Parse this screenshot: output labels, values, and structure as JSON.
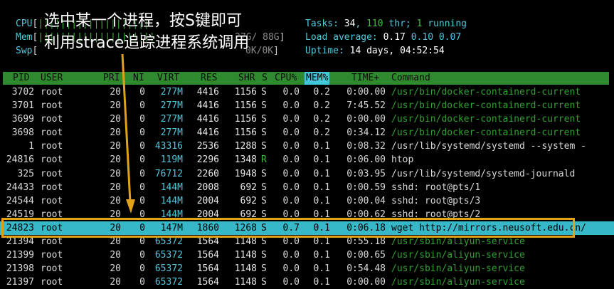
{
  "meters": {
    "cpu": {
      "label": "CPU",
      "bar": "||||||||||||||||||||",
      "value": ""
    },
    "mem": {
      "label": "Mem",
      "bar": "|||||||||||||||||||||",
      "value": "27G/ 88G"
    },
    "swp": {
      "label": "Swp",
      "bar": "",
      "value": "0K/0K"
    }
  },
  "stats": {
    "tasks_label": "Tasks: ",
    "tasks": "34",
    "threads_sep": ", ",
    "threads": "110",
    "threads_label": " thr; ",
    "running": "1",
    "running_label": " running",
    "load_label": "Load average: ",
    "load1": "0.17",
    "load5": "0.10",
    "load15": "0.07",
    "uptime_label": "Uptime: ",
    "uptime": "14 days, 04:52:54"
  },
  "annotation": {
    "line1": "选中某一个进程，按S键即可",
    "line2": "利用strace追踪进程系统调用"
  },
  "header": {
    "pid": "PID",
    "user": "USER",
    "pri": "PRI",
    "ni": "NI",
    "virt": "VIRT",
    "res": "RES",
    "shr": "SHR",
    "s": "S",
    "cpu": "CPU%",
    "mem": "MEM%",
    "time": "TIME+",
    "command": "Command"
  },
  "processes": [
    {
      "pid": "3702",
      "user": "root",
      "pri": "20",
      "ni": "0",
      "virt": "277M",
      "res": "4416",
      "shr": "1156",
      "s": "S",
      "cpu": "0.0",
      "mem": "0.2",
      "time": "0:00.00",
      "command": "/usr/bin/docker-containerd-current",
      "thread": true
    },
    {
      "pid": "3701",
      "user": "root",
      "pri": "20",
      "ni": "0",
      "virt": "277M",
      "res": "4416",
      "shr": "1156",
      "s": "S",
      "cpu": "0.0",
      "mem": "0.2",
      "time": "7:45.52",
      "command": "/usr/bin/docker-containerd-current",
      "thread": true
    },
    {
      "pid": "3699",
      "user": "root",
      "pri": "20",
      "ni": "0",
      "virt": "277M",
      "res": "4416",
      "shr": "1156",
      "s": "S",
      "cpu": "0.0",
      "mem": "0.2",
      "time": "0:00.00",
      "command": "/usr/bin/docker-containerd-current",
      "thread": true
    },
    {
      "pid": "3698",
      "user": "root",
      "pri": "20",
      "ni": "0",
      "virt": "277M",
      "res": "4416",
      "shr": "1156",
      "s": "S",
      "cpu": "0.0",
      "mem": "0.2",
      "time": "0:34.12",
      "command": "/usr/bin/docker-containerd-current",
      "thread": true
    },
    {
      "pid": "1",
      "user": "root",
      "pri": "20",
      "ni": "0",
      "virt": "43316",
      "res": "2536",
      "shr": "1288",
      "s": "S",
      "cpu": "0.0",
      "mem": "0.1",
      "time": "0:08.32",
      "command": "/usr/lib/systemd/systemd --system -",
      "thread": false
    },
    {
      "pid": "24816",
      "user": "root",
      "pri": "20",
      "ni": "0",
      "virt": "119M",
      "res": "2296",
      "shr": "1348",
      "s": "R",
      "cpu": "0.0",
      "mem": "0.1",
      "time": "0:06.00",
      "command": "htop",
      "thread": false
    },
    {
      "pid": "325",
      "user": "root",
      "pri": "20",
      "ni": "0",
      "virt": "76712",
      "res": "2260",
      "shr": "1948",
      "s": "S",
      "cpu": "0.0",
      "mem": "0.1",
      "time": "0:03.95",
      "command": "/usr/lib/systemd/systemd-journald",
      "thread": false
    },
    {
      "pid": "24433",
      "user": "root",
      "pri": "20",
      "ni": "0",
      "virt": "144M",
      "res": "2008",
      "shr": "692",
      "s": "S",
      "cpu": "0.0",
      "mem": "0.1",
      "time": "0:00.59",
      "command": "sshd: root@pts/1",
      "thread": false
    },
    {
      "pid": "24544",
      "user": "root",
      "pri": "20",
      "ni": "0",
      "virt": "144M",
      "res": "2004",
      "shr": "692",
      "s": "S",
      "cpu": "0.0",
      "mem": "0.1",
      "time": "0:00.04",
      "command": "sshd: root@pts/3",
      "thread": false
    },
    {
      "pid": "24519",
      "user": "root",
      "pri": "20",
      "ni": "0",
      "virt": "144M",
      "res": "2004",
      "shr": "692",
      "s": "S",
      "cpu": "0.0",
      "mem": "0.1",
      "time": "0:00.62",
      "command": "sshd: root@pts/2",
      "thread": false
    },
    {
      "pid": "24823",
      "user": "root",
      "pri": "20",
      "ni": "0",
      "virt": "147M",
      "res": "1860",
      "shr": "1268",
      "s": "S",
      "cpu": "0.7",
      "mem": "0.1",
      "time": "0:06.18",
      "command": "wget http://mirrors.neusoft.edu.cn/",
      "thread": false,
      "selected": true
    },
    {
      "pid": "21394",
      "user": "root",
      "pri": "20",
      "ni": "0",
      "virt": "65372",
      "res": "1564",
      "shr": "1148",
      "s": "S",
      "cpu": "0.0",
      "mem": "0.1",
      "time": "0:55.18",
      "command": "/usr/sbin/aliyun-service",
      "thread": true
    },
    {
      "pid": "21399",
      "user": "root",
      "pri": "20",
      "ni": "0",
      "virt": "65372",
      "res": "1564",
      "shr": "1148",
      "s": "S",
      "cpu": "0.0",
      "mem": "0.1",
      "time": "0:00.65",
      "command": "/usr/sbin/aliyun-service",
      "thread": true
    },
    {
      "pid": "21398",
      "user": "root",
      "pri": "20",
      "ni": "0",
      "virt": "65372",
      "res": "1564",
      "shr": "1148",
      "s": "S",
      "cpu": "0.0",
      "mem": "0.1",
      "time": "0:54.48",
      "command": "/usr/sbin/aliyun-service",
      "thread": true
    },
    {
      "pid": "21397",
      "user": "root",
      "pri": "20",
      "ni": "0",
      "virt": "65372",
      "res": "1564",
      "shr": "1148",
      "s": "S",
      "cpu": "0.0",
      "mem": "0.1",
      "time": "0:00.00",
      "command": "/usr/sbin/aliyun-service",
      "thread": true
    }
  ],
  "colors": {
    "background": "#000000",
    "header_bg": "#2f8a2f",
    "sorted_col": "#40c8d8",
    "selected_row": "#36b8c8",
    "highlight_box": "#e0a218",
    "thread_cmd": "#2fa02f",
    "label_cyan": "#4ec9e0"
  }
}
